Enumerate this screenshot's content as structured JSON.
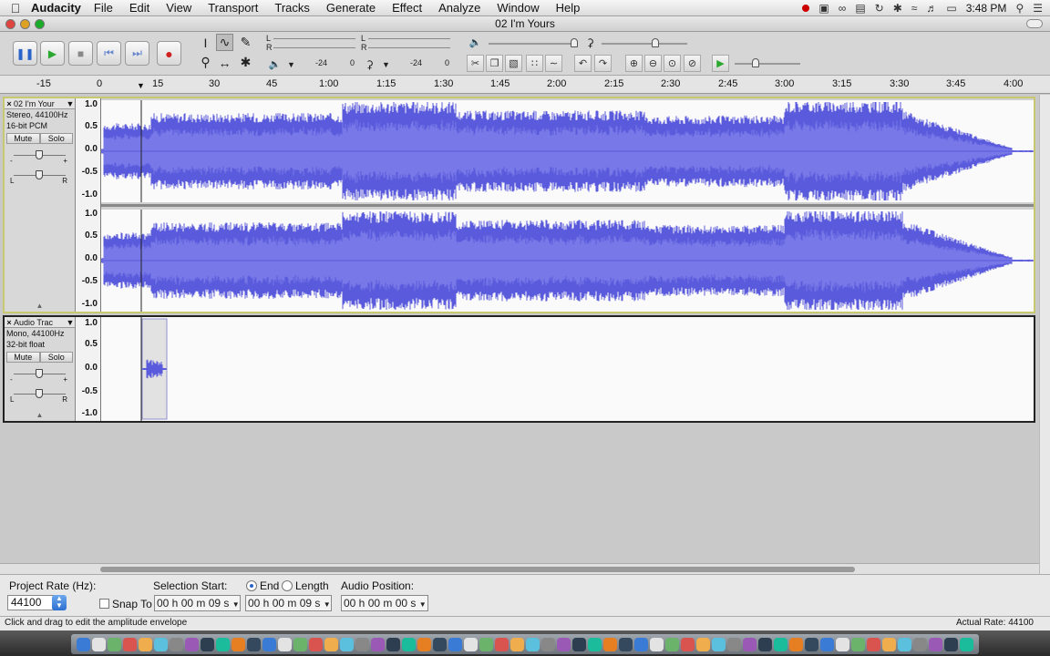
{
  "menubar": {
    "app_name": "Audacity",
    "menus": [
      "File",
      "Edit",
      "View",
      "Transport",
      "Tracks",
      "Generate",
      "Effect",
      "Analyze",
      "Window",
      "Help"
    ],
    "clock": "3:48 PM"
  },
  "window": {
    "title": "02 I'm Yours"
  },
  "meters": {
    "play_meter": {
      "left_label": "L",
      "right_label": "R",
      "tick_a": "-24",
      "tick_b": "0"
    },
    "record_meter": {
      "left_label": "L",
      "right_label": "R",
      "tick_a": "-24",
      "tick_b": "0"
    }
  },
  "ruler": {
    "ticks": [
      "-15",
      "0",
      "15",
      "30",
      "45",
      "1:00",
      "1:15",
      "1:30",
      "1:45",
      "2:00",
      "2:15",
      "2:30",
      "2:45",
      "3:00",
      "3:15",
      "3:30",
      "3:45",
      "4:00"
    ]
  },
  "tracks": [
    {
      "name": "02 I'm Your",
      "info_line1": "Stereo, 44100Hz",
      "info_line2": "16-bit PCM",
      "mute_label": "Mute",
      "solo_label": "Solo",
      "gain_left": "-",
      "gain_right": "+",
      "pan_left": "L",
      "pan_right": "R",
      "scale": [
        "1.0",
        "0.5",
        "0.0",
        "-0.5",
        "-1.0"
      ]
    },
    {
      "name": "Audio Trac",
      "info_line1": "Mono, 44100Hz",
      "info_line2": "32-bit float",
      "mute_label": "Mute",
      "solo_label": "Solo",
      "gain_left": "-",
      "gain_right": "+",
      "pan_left": "L",
      "pan_right": "R",
      "scale": [
        "1.0",
        "0.5",
        "0.0",
        "-0.5",
        "-1.0"
      ]
    }
  ],
  "selection_bar": {
    "project_rate_label": "Project Rate (Hz):",
    "project_rate_value": "44100",
    "snap_to_label": "Snap To",
    "selection_start_label": "Selection Start:",
    "end_label": "End",
    "length_label": "Length",
    "audio_position_label": "Audio Position:",
    "selection_start_value": "00 h 00 m 09 s",
    "selection_end_value": "00 h 00 m 09 s",
    "audio_position_value": "00 h 00 m 00 s",
    "end_selected": true
  },
  "status": {
    "message": "Click and drag to edit the amplitude envelope",
    "actual_rate": "Actual Rate: 44100"
  },
  "colors": {
    "waveform": "#5a5adc",
    "waveform_rms": "#7878e8",
    "selected_track_border": "#c8c870"
  }
}
